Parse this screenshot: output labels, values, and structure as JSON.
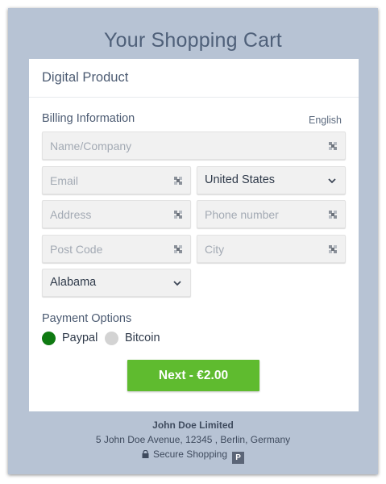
{
  "page": {
    "title": "Your Shopping Cart"
  },
  "card": {
    "header": "Digital Product",
    "billing_label": "Billing Information",
    "language": "English",
    "fields": {
      "name_placeholder": "Name/Company",
      "email_placeholder": "Email",
      "country_value": "United States",
      "address_placeholder": "Address",
      "phone_placeholder": "Phone number",
      "postcode_placeholder": "Post Code",
      "city_placeholder": "City",
      "state_value": "Alabama"
    },
    "payment": {
      "label": "Payment Options",
      "options": [
        {
          "label": "Paypal",
          "selected": true
        },
        {
          "label": "Bitcoin",
          "selected": false
        }
      ]
    },
    "next_button": "Next - €2.00"
  },
  "footer": {
    "company": "John Doe Limited",
    "address": "5 John Doe Avenue, 12345 , Berlin, Germany",
    "secure": "Secure Shopping",
    "badge": "P"
  },
  "colors": {
    "frame": "#b7c3d4",
    "accent_green": "#5fbb2f",
    "radio_selected": "#0f7a12"
  }
}
